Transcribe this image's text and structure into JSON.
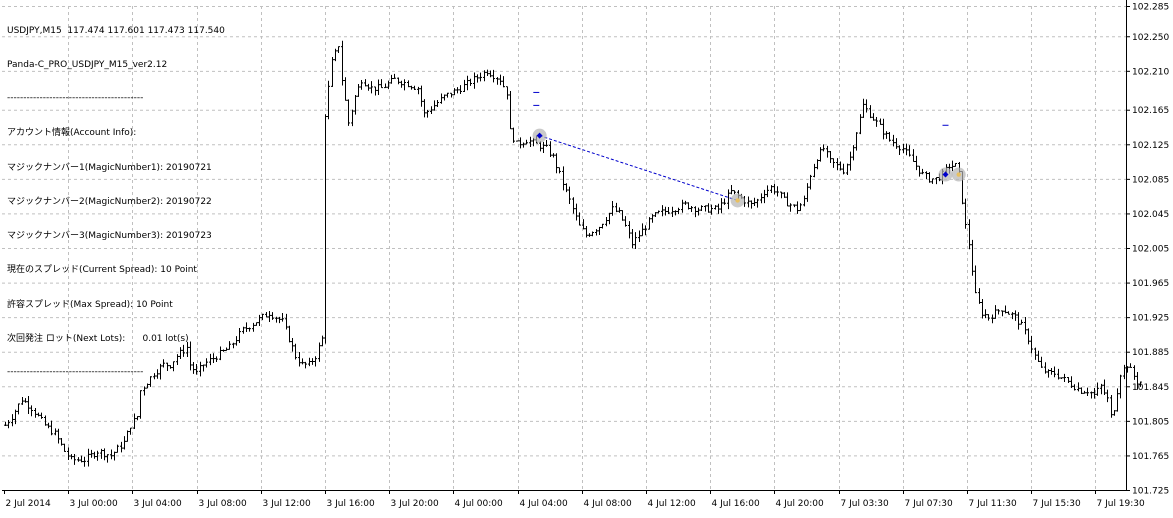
{
  "header": {
    "symbol_line": "USDJPY,M15  117.474 117.601 117.473 117.540",
    "ea_name": "Panda-C_PRO_USDJPY_M15_ver2.12",
    "separator": "------------------------------------------"
  },
  "info_panel": {
    "lines": [
      "アカウント情報(Account Info):",
      "マジックナンバー1(MagicNumber1): 20190721",
      "マジックナンバー2(MagicNumber2): 20190722",
      "マジックナンバー3(MagicNumber3): 20190723",
      "現在のスプレッド(Current Spread): 10 Point",
      "許容スプレッド(Max Spread): 10 Point",
      "次回発注 ロット(Next Lots):      0.01 lot(s)"
    ]
  },
  "colors": {
    "background": "#ffffff",
    "grid": "#c0c0c0",
    "bars": "#000000",
    "trade_marker": "#0000cc",
    "trade_line": "#0000cc",
    "marker_halo": "#b4b4b4",
    "close_marker": "#e8c060"
  },
  "chart_data": {
    "type": "ohlc",
    "symbol": "USDJPY",
    "timeframe": "M15",
    "ylim": [
      101.725,
      102.285
    ],
    "y_ticks": [
      "102.285",
      "102.250",
      "102.210",
      "102.165",
      "102.125",
      "102.085",
      "102.045",
      "102.005",
      "101.965",
      "101.925",
      "101.885",
      "101.845",
      "101.805",
      "101.765",
      "101.725"
    ],
    "x_ticks": [
      "2 Jul 2014",
      "3 Jul 00:00",
      "3 Jul 04:00",
      "3 Jul 08:00",
      "3 Jul 12:00",
      "3 Jul 16:00",
      "3 Jul 20:00",
      "4 Jul 00:00",
      "4 Jul 04:00",
      "4 Jul 08:00",
      "4 Jul 12:00",
      "4 Jul 16:00",
      "4 Jul 20:00",
      "7 Jul 03:30",
      "7 Jul 07:30",
      "7 Jul 11:30",
      "7 Jul 15:30",
      "7 Jul 19:30"
    ],
    "grid": true,
    "anchors": [
      [
        0,
        101.8
      ],
      [
        2,
        101.81
      ],
      [
        5,
        101.83
      ],
      [
        8,
        101.82
      ],
      [
        12,
        101.8
      ],
      [
        15,
        101.79
      ],
      [
        18,
        101.77
      ],
      [
        20,
        101.76
      ],
      [
        24,
        101.76
      ],
      [
        28,
        101.77
      ],
      [
        32,
        101.765
      ],
      [
        36,
        101.78
      ],
      [
        38,
        101.8
      ],
      [
        40,
        101.81
      ],
      [
        41,
        101.84
      ],
      [
        43,
        101.85
      ],
      [
        45,
        101.86
      ],
      [
        48,
        101.87
      ],
      [
        50,
        101.87
      ],
      [
        52,
        101.88
      ],
      [
        55,
        101.89
      ],
      [
        56,
        101.87
      ],
      [
        58,
        101.86
      ],
      [
        60,
        101.87
      ],
      [
        64,
        101.88
      ],
      [
        68,
        101.89
      ],
      [
        72,
        101.91
      ],
      [
        76,
        101.92
      ],
      [
        80,
        101.93
      ],
      [
        84,
        101.92
      ],
      [
        88,
        101.88
      ],
      [
        90,
        101.87
      ],
      [
        92,
        101.87
      ],
      [
        94,
        101.88
      ],
      [
        96,
        101.9
      ],
      [
        97,
        102.16
      ],
      [
        99,
        102.22
      ],
      [
        101,
        102.24
      ],
      [
        102,
        102.2
      ],
      [
        104,
        102.15
      ],
      [
        106,
        102.18
      ],
      [
        108,
        102.2
      ],
      [
        111,
        102.19
      ],
      [
        114,
        102.19
      ],
      [
        118,
        102.2
      ],
      [
        122,
        102.195
      ],
      [
        125,
        102.19
      ],
      [
        127,
        102.16
      ],
      [
        130,
        102.17
      ],
      [
        133,
        102.18
      ],
      [
        138,
        102.19
      ],
      [
        142,
        102.2
      ],
      [
        146,
        102.21
      ],
      [
        150,
        102.2
      ],
      [
        152,
        102.185
      ],
      [
        153,
        102.14
      ],
      [
        155,
        102.125
      ],
      [
        158,
        102.13
      ],
      [
        161,
        102.125
      ],
      [
        164,
        102.12
      ],
      [
        166,
        102.11
      ],
      [
        168,
        102.09
      ],
      [
        170,
        102.07
      ],
      [
        172,
        102.05
      ],
      [
        174,
        102.03
      ],
      [
        176,
        102.02
      ],
      [
        178,
        102.025
      ],
      [
        180,
        102.03
      ],
      [
        182,
        102.04
      ],
      [
        184,
        102.05
      ],
      [
        186,
        102.045
      ],
      [
        188,
        102.03
      ],
      [
        190,
        102.01
      ],
      [
        192,
        102.02
      ],
      [
        194,
        102.03
      ],
      [
        196,
        102.04
      ],
      [
        198,
        102.045
      ],
      [
        202,
        102.05
      ],
      [
        206,
        102.055
      ],
      [
        210,
        102.05
      ],
      [
        214,
        102.05
      ],
      [
        216,
        102.05
      ],
      [
        218,
        102.06
      ],
      [
        220,
        102.07
      ],
      [
        222,
        102.065
      ],
      [
        224,
        102.06
      ],
      [
        226,
        102.055
      ],
      [
        228,
        102.06
      ],
      [
        230,
        102.07
      ],
      [
        232,
        102.075
      ],
      [
        234,
        102.07
      ],
      [
        236,
        102.06
      ],
      [
        238,
        102.055
      ],
      [
        240,
        102.05
      ],
      [
        242,
        102.06
      ],
      [
        244,
        102.09
      ],
      [
        246,
        102.11
      ],
      [
        248,
        102.12
      ],
      [
        250,
        102.105
      ],
      [
        252,
        102.1
      ],
      [
        254,
        102.095
      ],
      [
        256,
        102.11
      ],
      [
        258,
        102.14
      ],
      [
        260,
        102.17
      ],
      [
        262,
        102.16
      ],
      [
        264,
        102.15
      ],
      [
        266,
        102.14
      ],
      [
        268,
        102.13
      ],
      [
        270,
        102.125
      ],
      [
        272,
        102.12
      ],
      [
        274,
        102.11
      ],
      [
        276,
        102.1
      ],
      [
        278,
        102.09
      ],
      [
        280,
        102.085
      ],
      [
        282,
        102.085
      ],
      [
        284,
        102.09
      ],
      [
        286,
        102.1
      ],
      [
        288,
        102.1
      ],
      [
        289,
        102.09
      ],
      [
        290,
        102.06
      ],
      [
        291,
        102.03
      ],
      [
        292,
        102.01
      ],
      [
        293,
        101.98
      ],
      [
        294,
        101.95
      ],
      [
        296,
        101.93
      ],
      [
        298,
        101.925
      ],
      [
        300,
        101.93
      ],
      [
        302,
        101.935
      ],
      [
        304,
        101.93
      ],
      [
        306,
        101.925
      ],
      [
        308,
        101.915
      ],
      [
        310,
        101.9
      ],
      [
        312,
        101.88
      ],
      [
        314,
        101.865
      ],
      [
        316,
        101.86
      ],
      [
        318,
        101.86
      ],
      [
        320,
        101.855
      ],
      [
        322,
        101.85
      ],
      [
        324,
        101.845
      ],
      [
        326,
        101.84
      ],
      [
        328,
        101.84
      ],
      [
        330,
        101.835
      ],
      [
        332,
        101.845
      ],
      [
        334,
        101.83
      ],
      [
        335,
        101.81
      ],
      [
        336,
        101.82
      ],
      [
        338,
        101.86
      ],
      [
        340,
        101.87
      ],
      [
        343,
        101.85
      ]
    ],
    "trade_line": {
      "start": [
        162,
        102.135
      ],
      "end": [
        222,
        102.06
      ]
    },
    "markers": [
      {
        "type": "entry",
        "index": 162,
        "price": 102.135
      },
      {
        "type": "close",
        "index": 222,
        "price": 102.06
      },
      {
        "type": "entry",
        "index": 285,
        "price": 102.09
      },
      {
        "type": "close",
        "index": 289,
        "price": 102.09
      }
    ],
    "dashes": [
      [
        161,
        102.185
      ],
      [
        161,
        102.17
      ],
      [
        285,
        102.147
      ]
    ]
  }
}
